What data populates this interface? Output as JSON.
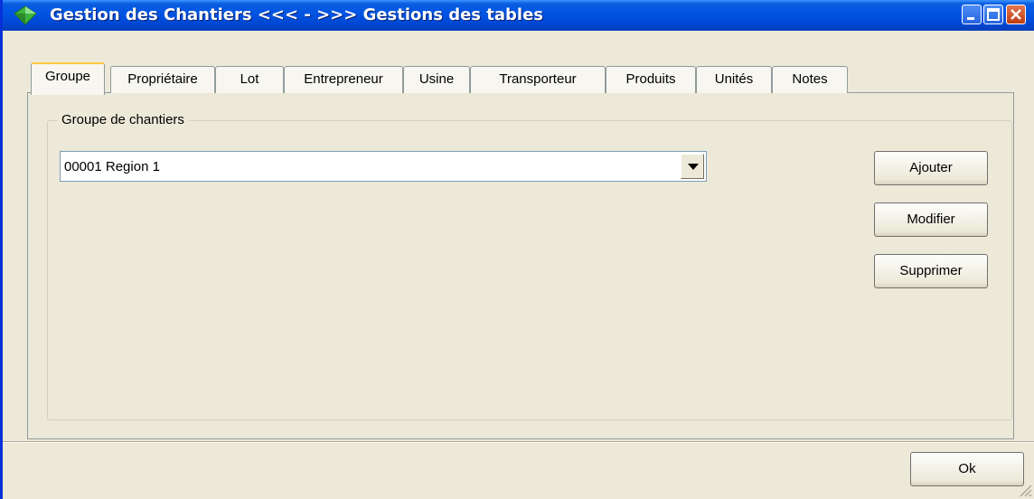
{
  "window": {
    "title": "Gestion des Chantiers <<< - >>> Gestions des tables",
    "icon": "green-gem-icon",
    "title_bar_color": "#0054e3"
  },
  "tabs": [
    {
      "label": "Groupe",
      "active": true
    },
    {
      "label": "Propriétaire",
      "active": false
    },
    {
      "label": "Lot",
      "active": false
    },
    {
      "label": "Entrepreneur",
      "active": false
    },
    {
      "label": "Usine",
      "active": false
    },
    {
      "label": "Transporteur",
      "active": false
    },
    {
      "label": "Produits",
      "active": false
    },
    {
      "label": "Unités",
      "active": false
    },
    {
      "label": "Notes",
      "active": false
    }
  ],
  "group": {
    "legend": "Groupe de chantiers",
    "combo_value": "00001 Region 1"
  },
  "buttons": {
    "add": "Ajouter",
    "modify": "Modifier",
    "delete": "Supprimer",
    "ok": "Ok"
  }
}
